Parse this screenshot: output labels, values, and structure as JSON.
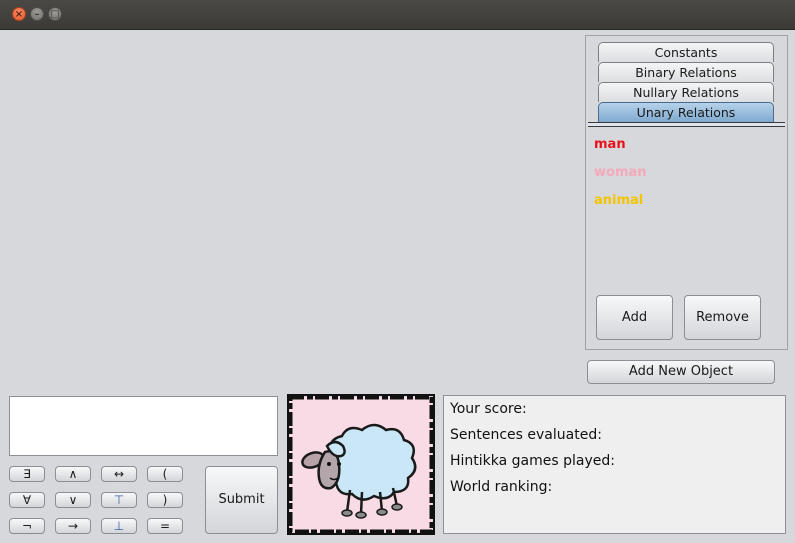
{
  "window": {
    "controls": [
      "close",
      "minimize",
      "maximize"
    ]
  },
  "tabs": [
    {
      "label": "Constants"
    },
    {
      "label": "Binary Relations"
    },
    {
      "label": "Nullary Relations"
    },
    {
      "label": "Unary Relations"
    }
  ],
  "active_tab": "Unary Relations",
  "relations": [
    {
      "name": "man",
      "color": "#e8121a"
    },
    {
      "name": "woman",
      "color": "#f5a8b8"
    },
    {
      "name": "animal",
      "color": "#f5c400"
    }
  ],
  "panel_buttons": {
    "add": "Add",
    "remove": "Remove"
  },
  "add_object_label": "Add New Object",
  "sentence_input": {
    "value": ""
  },
  "symbols": [
    "∃",
    "∧",
    "↔",
    "(",
    "∀",
    "∨",
    "⊤",
    ")",
    "¬",
    "→",
    "⊥",
    "="
  ],
  "submit_label": "Submit",
  "score_panel": {
    "score": "Your score:",
    "sentences": "Sentences evaluated:",
    "games": "Hintikka games played:",
    "ranking": "World ranking:"
  }
}
